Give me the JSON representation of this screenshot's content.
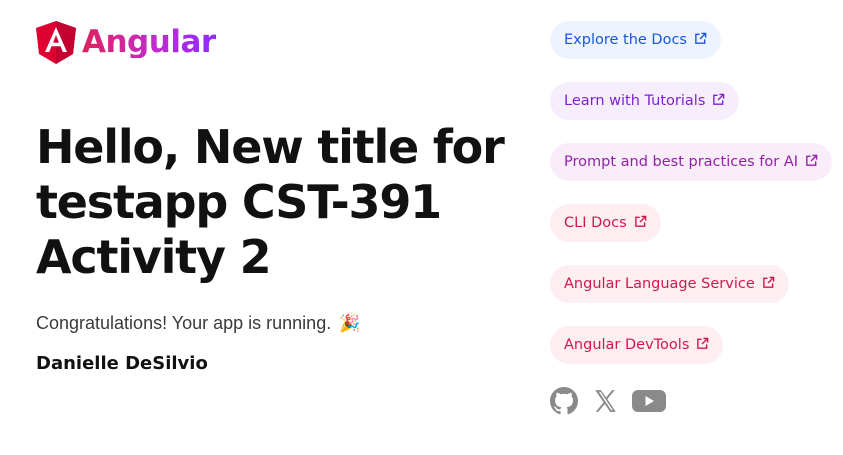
{
  "brand": {
    "name": "Angular",
    "logo_icon": "angular-shield-icon"
  },
  "main": {
    "headline": "Hello, New title for testapp CST-391 Activity 2",
    "congrats": "Congratulations! Your app is running.",
    "party_emoji": "🎉",
    "author": "Danielle DeSilvio"
  },
  "links": [
    {
      "label": "Explore the Docs",
      "icon": "external-link-icon",
      "text_color": "#1a56db",
      "bg_color": "#eef4ff"
    },
    {
      "label": "Learn with Tutorials",
      "icon": "external-link-icon",
      "text_color": "#7e22ce",
      "bg_color": "#f7eefd"
    },
    {
      "label": "Prompt and best practices for AI",
      "icon": "external-link-icon",
      "text_color": "#9321a8",
      "bg_color": "#faedfa"
    },
    {
      "label": "CLI Docs",
      "icon": "external-link-icon",
      "text_color": "#d1184e",
      "bg_color": "#fdeef2"
    },
    {
      "label": "Angular Language Service",
      "icon": "external-link-icon",
      "text_color": "#d1184e",
      "bg_color": "#fdeef2"
    },
    {
      "label": "Angular DevTools",
      "icon": "external-link-icon",
      "text_color": "#d1184e",
      "bg_color": "#fdeef2"
    }
  ],
  "social": [
    {
      "icon": "github-icon"
    },
    {
      "icon": "x-twitter-icon"
    },
    {
      "icon": "youtube-icon"
    }
  ],
  "colors": {
    "social_icon": "#8a8a8a",
    "logo_red": "#dd0031",
    "logo_dark_red": "#c3002f"
  }
}
